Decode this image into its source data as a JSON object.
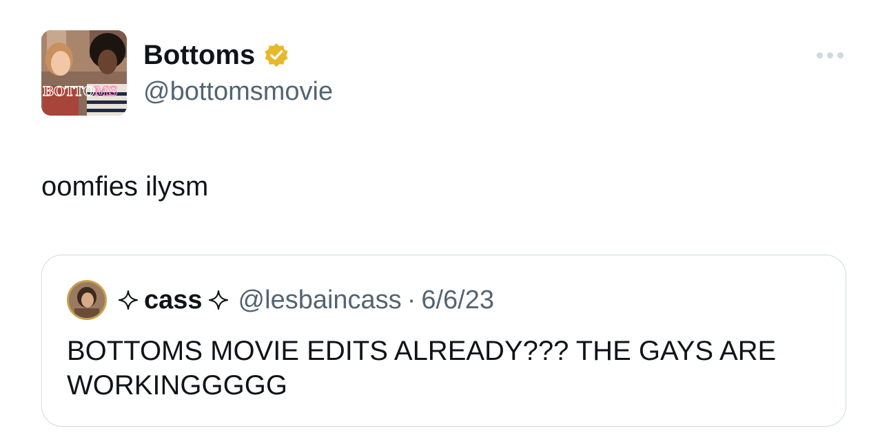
{
  "author": {
    "display_name": "Bottoms",
    "handle": "@bottomsmovie",
    "verified": true,
    "verified_badge_color": "#e8b829",
    "avatar_logo_text": "BOTTOMS"
  },
  "tweet": {
    "text": "oomfies ilysm"
  },
  "quoted_tweet": {
    "display_name": "cass",
    "name_decoration": "sparkle-icon",
    "handle": "@lesbaincass",
    "separator": "·",
    "date": "6/6/23",
    "text": "BOTTOMS MOVIE EDITS ALREADY??? THE GAYS ARE WORKINGGGGG"
  },
  "colors": {
    "text_primary": "#0f1419",
    "text_secondary": "#536471",
    "border": "#cfd9de"
  },
  "icons": {
    "more": "more-horizontal-icon",
    "verified": "verified-badge-icon",
    "sparkle": "sparkle-icon"
  }
}
